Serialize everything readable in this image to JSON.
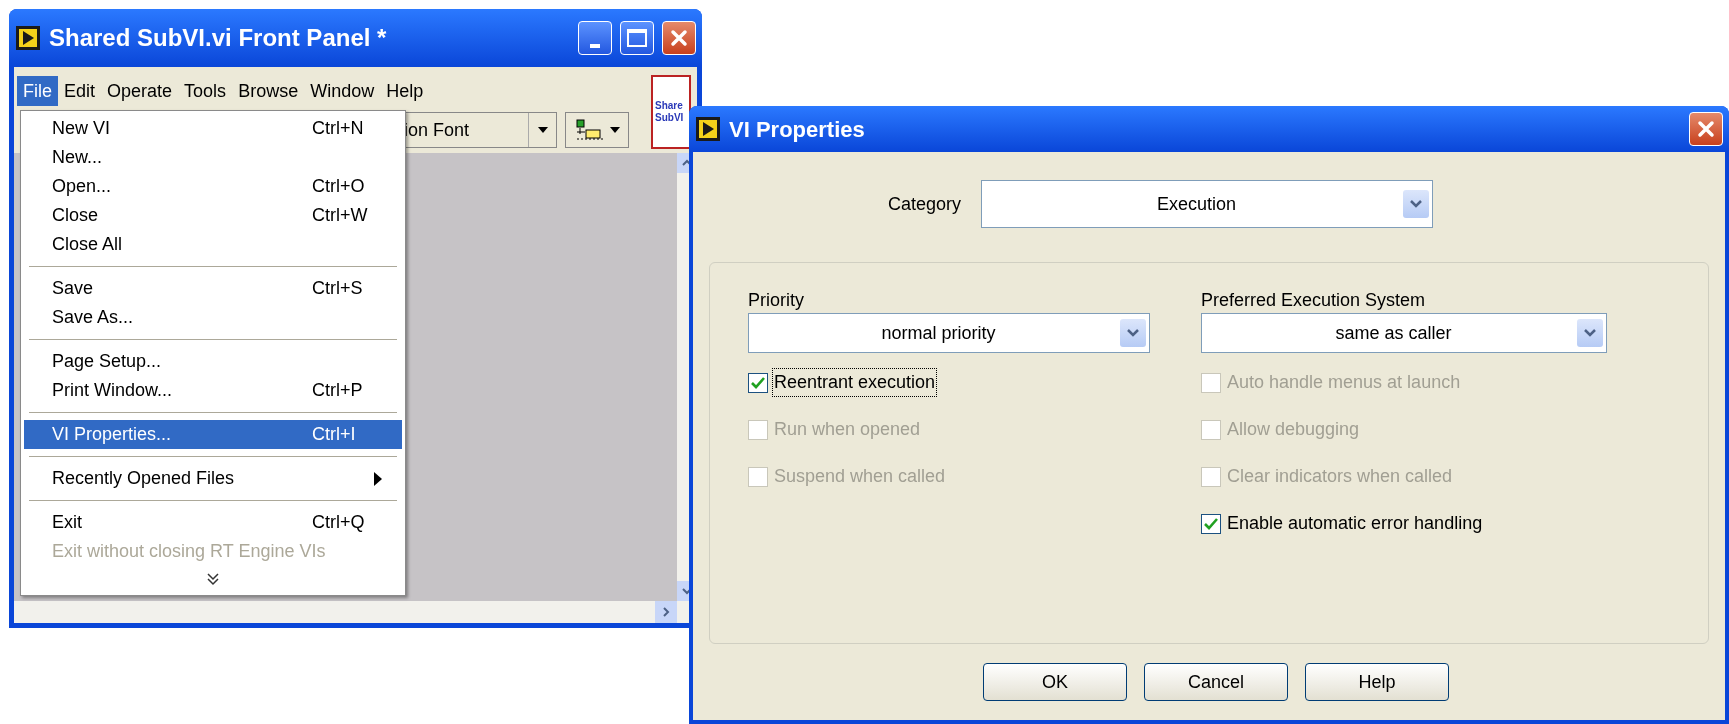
{
  "main_window": {
    "title": "Shared SubVI.vi Front Panel *",
    "menu_bar": [
      {
        "label": "File",
        "selected": true
      },
      {
        "label": "Edit",
        "selected": false
      },
      {
        "label": "Operate",
        "selected": false
      },
      {
        "label": "Tools",
        "selected": false
      },
      {
        "label": "Browse",
        "selected": false
      },
      {
        "label": "Window",
        "selected": false
      },
      {
        "label": "Help",
        "selected": false
      }
    ],
    "font_dropdown": "ion Font",
    "vi_icon_text": [
      "Share",
      "SubVI"
    ]
  },
  "file_menu": [
    {
      "kind": "item",
      "label": "New VI",
      "shortcut": "Ctrl+N",
      "selected": false,
      "disabled": false
    },
    {
      "kind": "item",
      "label": "New...",
      "selected": false,
      "disabled": false
    },
    {
      "kind": "item",
      "label": "Open...",
      "shortcut": "Ctrl+O",
      "selected": false,
      "disabled": false
    },
    {
      "kind": "item",
      "label": "Close",
      "shortcut": "Ctrl+W",
      "selected": false,
      "disabled": false
    },
    {
      "kind": "item",
      "label": "Close All",
      "selected": false,
      "disabled": false
    },
    {
      "kind": "separator"
    },
    {
      "kind": "item",
      "label": "Save",
      "shortcut": "Ctrl+S",
      "selected": false,
      "disabled": false
    },
    {
      "kind": "item",
      "label": "Save As...",
      "selected": false,
      "disabled": false
    },
    {
      "kind": "separator"
    },
    {
      "kind": "item",
      "label": "Page Setup...",
      "selected": false,
      "disabled": false
    },
    {
      "kind": "item",
      "label": "Print Window...",
      "shortcut": "Ctrl+P",
      "selected": false,
      "disabled": false
    },
    {
      "kind": "separator"
    },
    {
      "kind": "item",
      "label": "VI Properties...",
      "shortcut": "Ctrl+I",
      "selected": true,
      "disabled": false
    },
    {
      "kind": "separator"
    },
    {
      "kind": "submenu",
      "label": "Recently Opened Files",
      "selected": false,
      "disabled": false
    },
    {
      "kind": "separator"
    },
    {
      "kind": "item",
      "label": "Exit",
      "shortcut": "Ctrl+Q",
      "selected": false,
      "disabled": false
    },
    {
      "kind": "item",
      "label": "Exit without closing RT Engine VIs",
      "selected": false,
      "disabled": true
    },
    {
      "kind": "more"
    }
  ],
  "dialog": {
    "title": "VI Properties",
    "category": {
      "label": "Category",
      "value": "Execution"
    },
    "left": {
      "label": "Priority",
      "value": "normal priority",
      "checkboxes": [
        {
          "label": "Reentrant execution",
          "checked": true,
          "disabled": false,
          "focused": true
        },
        {
          "label": "Run when opened",
          "checked": false,
          "disabled": true,
          "focused": false
        },
        {
          "label": "Suspend when called",
          "checked": false,
          "disabled": true,
          "focused": false
        }
      ]
    },
    "right": {
      "label": "Preferred Execution System",
      "value": "same as caller",
      "checkboxes": [
        {
          "label": "Auto handle menus at launch",
          "checked": false,
          "disabled": true,
          "focused": false
        },
        {
          "label": "Allow debugging",
          "checked": false,
          "disabled": true,
          "focused": false
        },
        {
          "label": "Clear indicators when called",
          "checked": false,
          "disabled": true,
          "focused": false
        },
        {
          "label": "Enable automatic error handling",
          "checked": true,
          "disabled": false,
          "focused": false
        }
      ]
    },
    "buttons": [
      "OK",
      "Cancel",
      "Help"
    ]
  }
}
